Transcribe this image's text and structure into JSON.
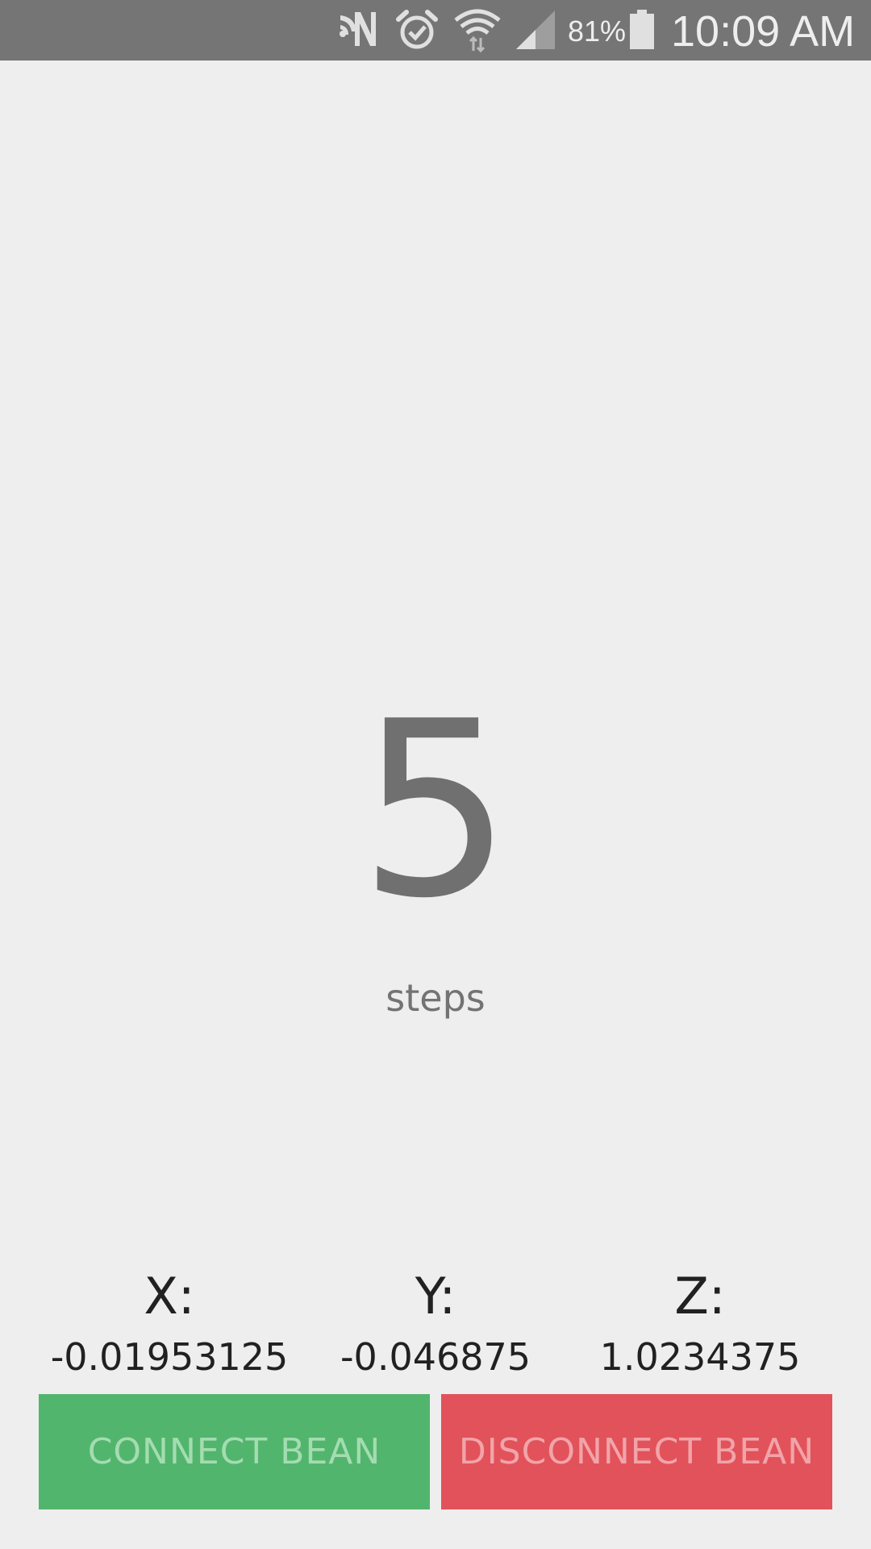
{
  "status_bar": {
    "battery_percent": "81%",
    "time": "10:09 AM",
    "icons": [
      "nfc-icon",
      "alarm-icon",
      "wifi-icon",
      "signal-icon",
      "battery-icon"
    ]
  },
  "counter": {
    "value": "5",
    "unit": "steps"
  },
  "accelerometer": {
    "x": {
      "label": "X:",
      "value": "-0.01953125"
    },
    "y": {
      "label": "Y:",
      "value": "-0.046875"
    },
    "z": {
      "label": "Z:",
      "value": "1.0234375"
    }
  },
  "buttons": {
    "connect": "CONNECT BEAN",
    "disconnect": "DISCONNECT BEAN"
  },
  "colors": {
    "status_bar": "#757575",
    "background": "#eeeeee",
    "connect": "#52b56d",
    "disconnect": "#e2525a"
  }
}
